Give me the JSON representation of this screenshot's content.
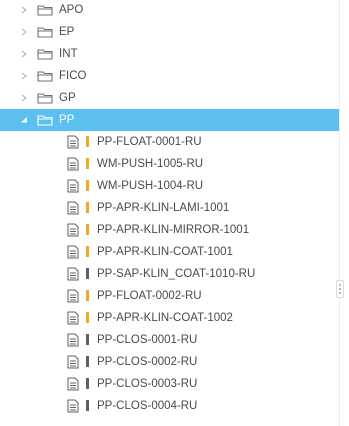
{
  "tree": {
    "folders_before": [
      {
        "label": "APO",
        "icon": "folder-icon",
        "expanded": false
      },
      {
        "label": "EP",
        "icon": "folder-icon",
        "expanded": false
      },
      {
        "label": "INT",
        "icon": "folder-icon",
        "expanded": false
      },
      {
        "label": "FICO",
        "icon": "folder-icon",
        "expanded": false
      },
      {
        "label": "GP",
        "icon": "folder-icon",
        "expanded": false
      }
    ],
    "selected_folder": {
      "label": "PP",
      "icon": "folder-open-icon",
      "expanded": true
    },
    "children": [
      {
        "label": "PP-FLOAT-0001-RU",
        "status_color": "#f5a623"
      },
      {
        "label": "WM-PUSH-1005-RU",
        "status_color": "#f5a623"
      },
      {
        "label": "WM-PUSH-1004-RU",
        "status_color": "#f5a623"
      },
      {
        "label": "PP-APR-KLIN-LAMI-1001",
        "status_color": "#f5a623"
      },
      {
        "label": "PP-APR-KLIN-MIRROR-1001",
        "status_color": "#f5a623"
      },
      {
        "label": "PP-APR-KLIN-COAT-1001",
        "status_color": "#f5a623"
      },
      {
        "label": "PP-SAP-KLIN_COAT-1010-RU",
        "status_color": "#5c6066"
      },
      {
        "label": "PP-FLOAT-0002-RU",
        "status_color": "#f5a623"
      },
      {
        "label": "PP-APR-KLIN-COAT-1002",
        "status_color": "#f5a623"
      },
      {
        "label": "PP-CLOS-0001-RU",
        "status_color": "#5c6066"
      },
      {
        "label": "PP-CLOS-0002-RU",
        "status_color": "#5c6066"
      },
      {
        "label": "PP-CLOS-0003-RU",
        "status_color": "#5c6066"
      },
      {
        "label": "PP-CLOS-0004-RU",
        "status_color": "#5c6066"
      }
    ]
  },
  "colors": {
    "selection": "#5bc0f0",
    "text": "#444b52",
    "icon": "#6b7178",
    "caret": "#a7adb3"
  }
}
